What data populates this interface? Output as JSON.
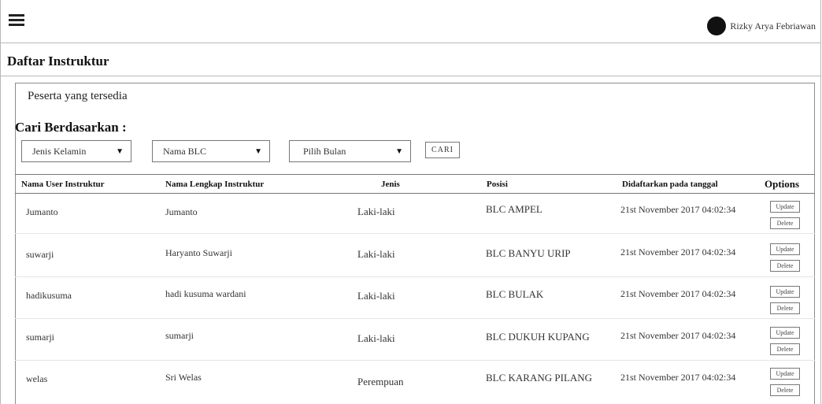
{
  "user": {
    "name": "Rizky Arya Febriawan"
  },
  "page_title": "Daftar Instruktur",
  "peserta_label": "Peserta yang tersedia",
  "search": {
    "label": "Cari Berdasarkan :",
    "filter_gender": "Jenis Kelamin",
    "filter_blc": "Nama BLC",
    "filter_month": "Pilih Bulan",
    "search_button": "CARI"
  },
  "table": {
    "headers": [
      "Nama User Instruktur",
      "Nama Lengkap Instruktur",
      "Jenis",
      "Posisi",
      "Didaftarkan pada tanggal",
      "Options"
    ],
    "update_label": "Update",
    "delete_label": "Delete",
    "rows": [
      {
        "username": "Jumanto",
        "fullname": "Jumanto",
        "jenis": "Laki-laki",
        "posisi": "BLC AMPEL",
        "tanggal": "21st November 2017 04:02:34"
      },
      {
        "username": "suwarji",
        "fullname": "Haryanto Suwarji",
        "jenis": "Laki-laki",
        "posisi": "BLC BANYU URIP",
        "tanggal": "21st November 2017 04:02:34"
      },
      {
        "username": "hadikusuma",
        "fullname": "hadi kusuma wardani",
        "jenis": "Laki-laki",
        "posisi": "BLC BULAK",
        "tanggal": "21st November 2017 04:02:34"
      },
      {
        "username": "sumarji",
        "fullname": "sumarji",
        "jenis": "Laki-laki",
        "posisi": "BLC DUKUH KUPANG",
        "tanggal": "21st November 2017 04:02:34"
      },
      {
        "username": "welas",
        "fullname": "Sri Welas",
        "jenis": "Perempuan",
        "posisi": "BLC KARANG PILANG",
        "tanggal": "21st November 2017 04:02:34"
      }
    ]
  },
  "icons": {
    "menu": "hamburger-menu-icon",
    "avatar": "user-avatar-icon",
    "dropdown": "chevron-down-icon"
  }
}
